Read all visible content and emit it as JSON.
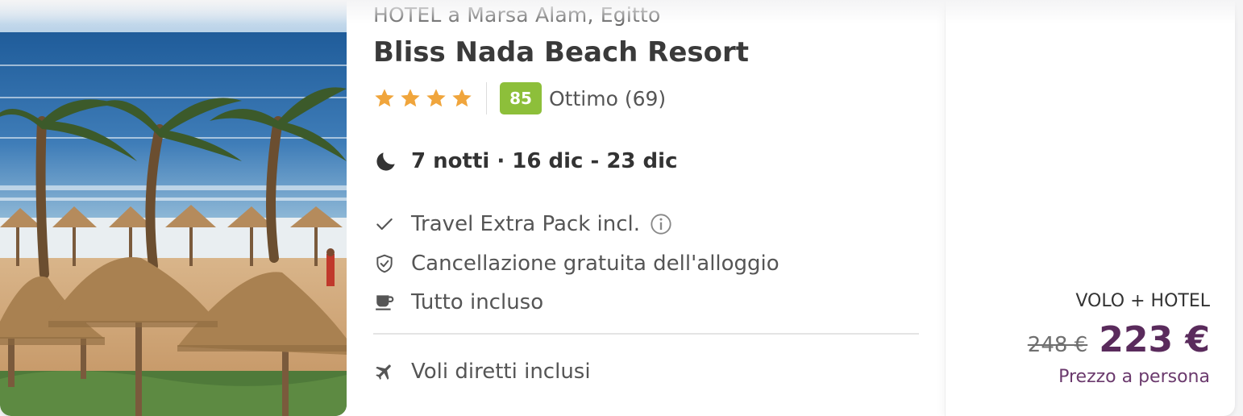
{
  "hotel": {
    "location": "HOTEL a Marsa Alam, Egitto",
    "name": "Bliss Nada Beach Resort",
    "stars": 4,
    "score": "85",
    "score_label": "Ottimo (69)"
  },
  "stay": {
    "summary": "7 notti · 16 dic - 23 dic",
    "icon": "moon-icon"
  },
  "features": [
    {
      "icon": "check-icon",
      "label": "Travel Extra Pack incl."
    },
    {
      "icon": "shield-check-icon",
      "label": "Cancellazione gratuita dell'alloggio"
    },
    {
      "icon": "coffee-cup-icon",
      "label": "Tutto incluso"
    }
  ],
  "flights": {
    "icon": "airplane-icon",
    "label": "Voli diretti inclusi"
  },
  "pricing": {
    "package": "VOLO + HOTEL",
    "old_price": "248 €",
    "price": "223 €",
    "per_person": "Prezzo a persona"
  },
  "colors": {
    "star": "#f0a53c",
    "score_badge": "#8dbf3a",
    "price": "#5a2b5c"
  }
}
